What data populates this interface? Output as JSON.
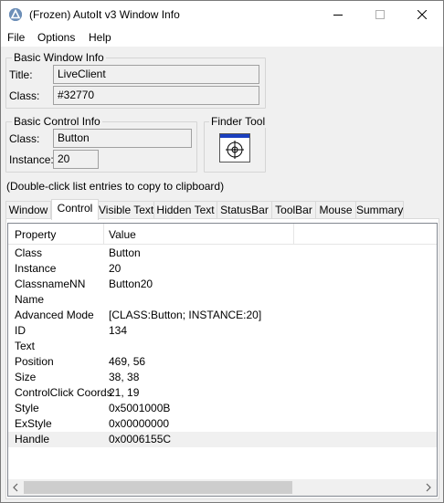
{
  "window": {
    "title": "(Frozen) AutoIt v3 Window Info"
  },
  "menu": {
    "items": [
      {
        "label": "File"
      },
      {
        "label": "Options"
      },
      {
        "label": "Help"
      }
    ]
  },
  "basic_window_info": {
    "group_label": "Basic Window Info",
    "title_label": "Title:",
    "title_value": "LiveClient",
    "class_label": "Class:",
    "class_value": "#32770"
  },
  "basic_control_info": {
    "group_label": "Basic Control Info",
    "class_label": "Class:",
    "class_value": "Button",
    "instance_label": "Instance:",
    "instance_value": "20"
  },
  "finder_tool": {
    "label": "Finder Tool",
    "icon": "crosshair-target-icon"
  },
  "hint_text": "(Double-click list entries to copy to clipboard)",
  "tabs": [
    {
      "label": "Window"
    },
    {
      "label": "Control"
    },
    {
      "label": "Visible Text"
    },
    {
      "label": "Hidden Text"
    },
    {
      "label": "StatusBar"
    },
    {
      "label": "ToolBar"
    },
    {
      "label": "Mouse"
    },
    {
      "label": "Summary"
    }
  ],
  "active_tab": "Control",
  "list": {
    "columns": [
      "Property",
      "Value"
    ],
    "rows": [
      {
        "property": "Class",
        "value": "Button"
      },
      {
        "property": "Instance",
        "value": "20"
      },
      {
        "property": "ClassnameNN",
        "value": "Button20"
      },
      {
        "property": "Name",
        "value": ""
      },
      {
        "property": "Advanced Mode",
        "value": "[CLASS:Button; INSTANCE:20]"
      },
      {
        "property": "ID",
        "value": "134"
      },
      {
        "property": "Text",
        "value": ""
      },
      {
        "property": "Position",
        "value": "469, 56"
      },
      {
        "property": "Size",
        "value": "38, 38"
      },
      {
        "property": "ControlClick Coords",
        "value": "21, 19"
      },
      {
        "property": "Style",
        "value": "0x5001000B"
      },
      {
        "property": "ExStyle",
        "value": "0x00000000"
      },
      {
        "property": "Handle",
        "value": "0x0006155C"
      }
    ],
    "selected_row": "Handle"
  },
  "colors": {
    "accent": "#0078d7",
    "finder_icon_blue": "#1a3fbf"
  }
}
